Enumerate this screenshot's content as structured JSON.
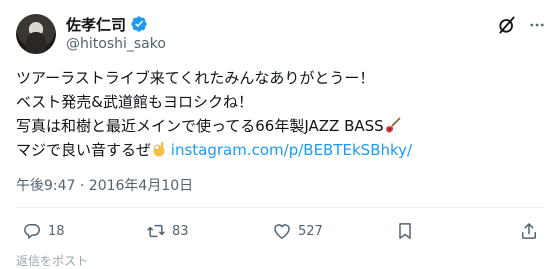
{
  "author": {
    "display_name": "佐孝仁司",
    "handle": "@hitoshi_sako",
    "verified": true,
    "avatar_icon": "profile-photo"
  },
  "tweet": {
    "line1": "ツアーラストライブ来てくれたみんなありがとうー！",
    "line2": "ベスト発売&武道館もヨロシクね！",
    "line3": "写真は和樹と最近メインで使ってる66年製JAZZ BASS",
    "line3_emoji": "guitar-emoji",
    "line4": "マジで良い音するぜ",
    "line4_emoji": "ok-hand-emoji",
    "link": "instagram.com/p/BEBTEkSBhky/"
  },
  "meta": {
    "timestamp": "午後9:47 · 2016年4月10日"
  },
  "actions": {
    "reply_count": "18",
    "retweet_count": "83",
    "like_count": "527"
  },
  "footer_partial": "返信をポスト"
}
